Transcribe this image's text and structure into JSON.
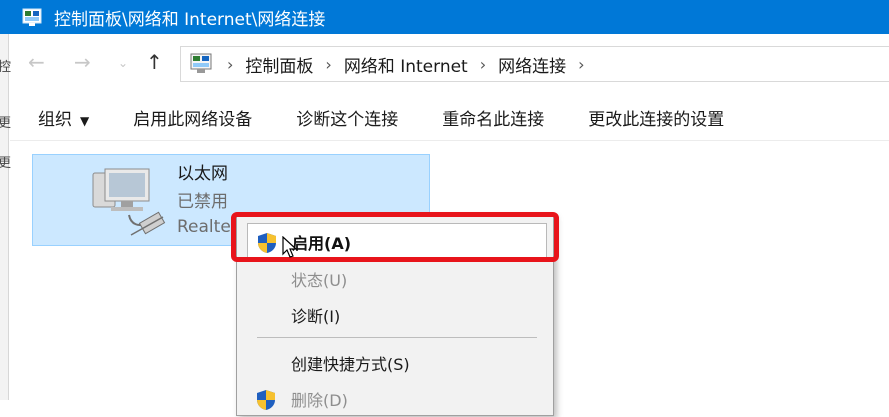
{
  "window": {
    "title": "控制面板\\网络和 Internet\\网络连接",
    "icon": "control-panel-icon"
  },
  "parent_window_edge": {
    "fragments": [
      "控",
      "更",
      "更"
    ]
  },
  "nav": {
    "back_icon": "arrow-left-icon",
    "forward_icon": "arrow-right-icon",
    "recent_icon": "chevron-down-icon",
    "up_icon": "arrow-up-icon",
    "address": {
      "icon": "control-panel-icon",
      "separator": "›",
      "crumbs": [
        "控制面板",
        "网络和 Internet",
        "网络连接"
      ]
    }
  },
  "commands": {
    "organize": "组织",
    "enable_device": "启用此网络设备",
    "diagnose": "诊断这个连接",
    "rename": "重命名此连接",
    "change_settings": "更改此连接的设置"
  },
  "connection": {
    "name": "以太网",
    "status": "已禁用",
    "adapter": "Realte",
    "icon": "ethernet-adapter-icon"
  },
  "context_menu": {
    "items": [
      {
        "label": "启用(A)",
        "enabled": true,
        "highlighted": true,
        "icon": "uac-shield-icon"
      },
      {
        "label": "状态(U)",
        "enabled": false
      },
      {
        "label": "诊断(I)",
        "enabled": true
      },
      {
        "label": "创建快捷方式(S)",
        "enabled": true
      },
      {
        "label": "删除(D)",
        "enabled": false,
        "icon": "uac-shield-icon"
      }
    ]
  },
  "colors": {
    "titlebar": "#0078d7",
    "selection": "#cce8ff",
    "highlight_box": "#e8141b"
  }
}
